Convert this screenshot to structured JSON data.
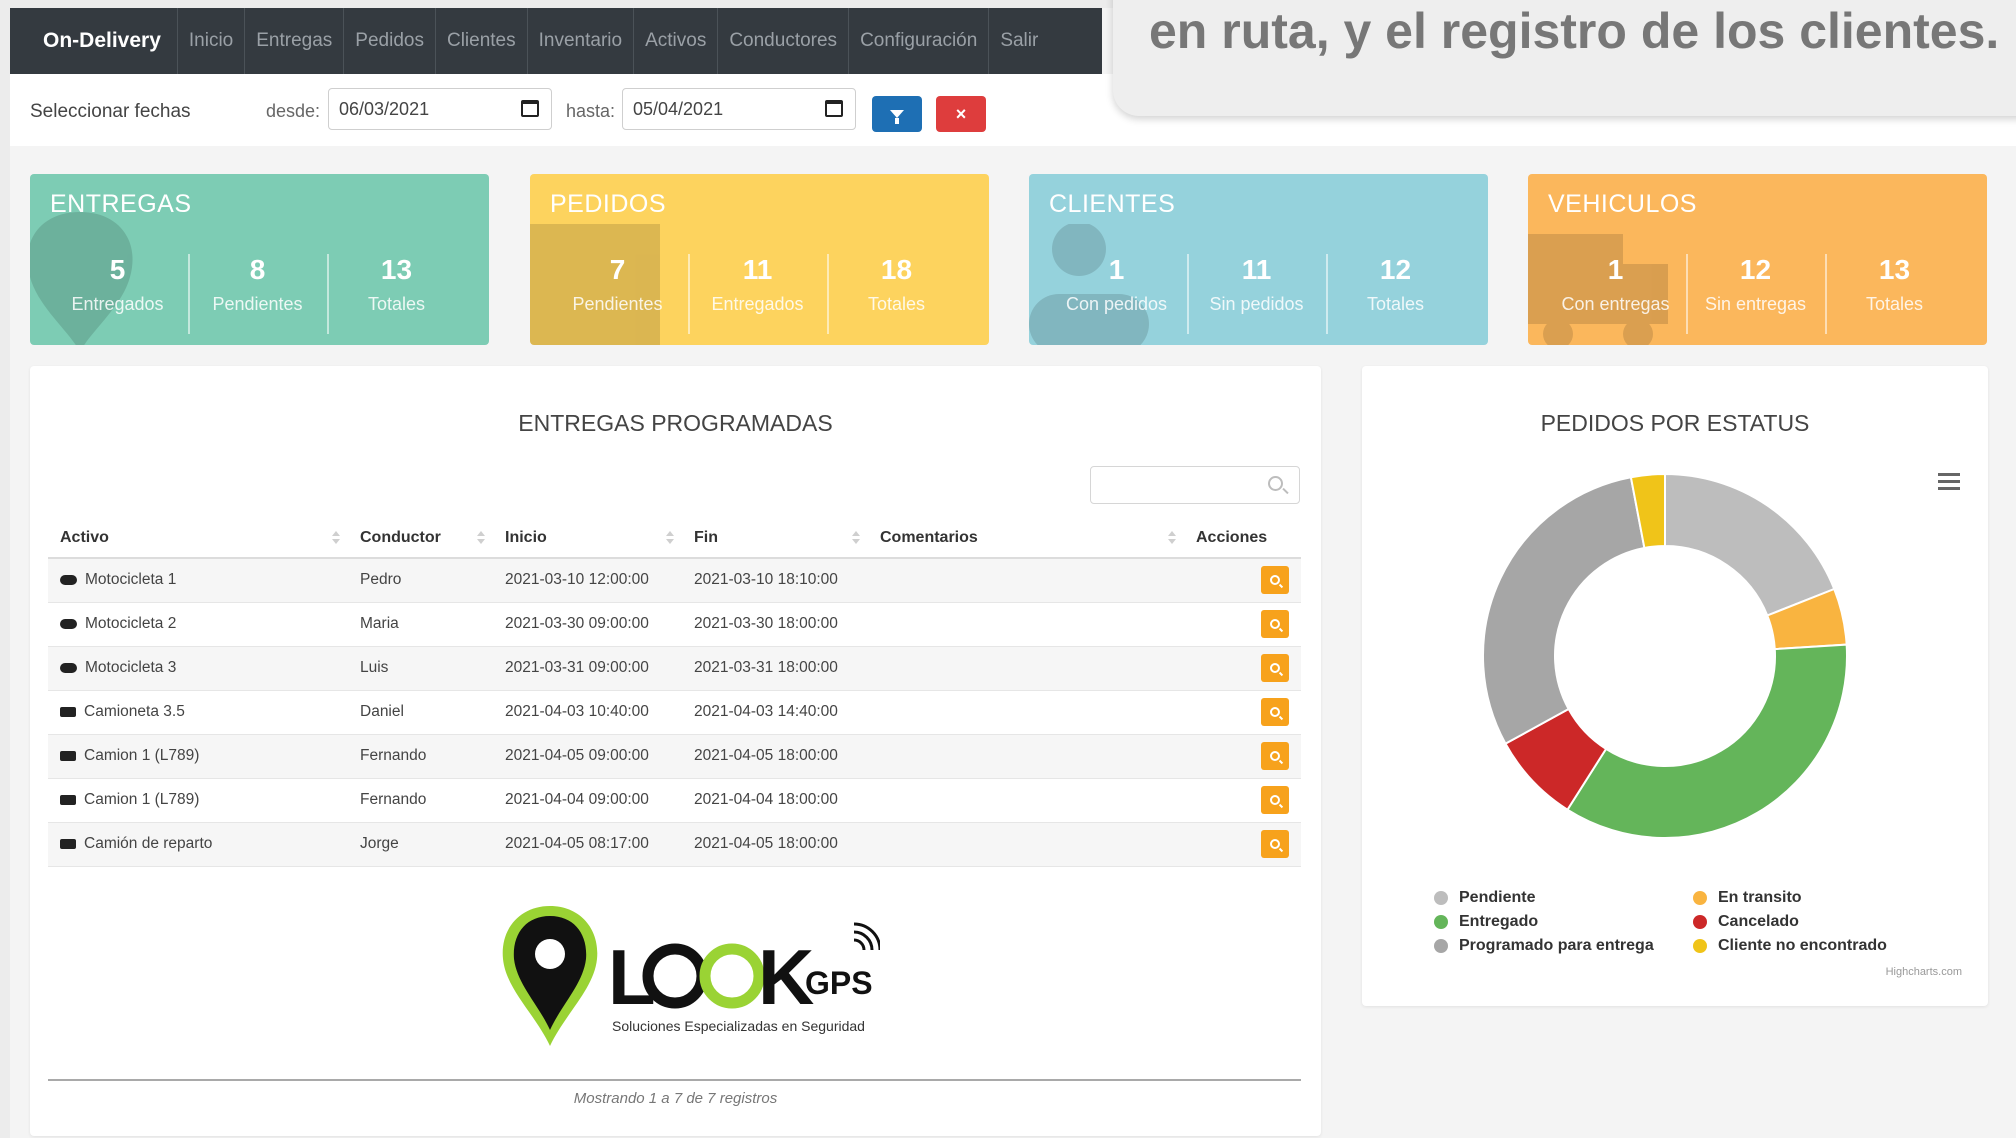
{
  "caption": "en ruta, y el registro de los clientes.",
  "navbar": {
    "brand": "On-Delivery",
    "items": [
      "Inicio",
      "Entregas",
      "Pedidos",
      "Clientes",
      "Inventario",
      "Activos",
      "Conductores",
      "Configuración",
      "Salir"
    ]
  },
  "filter": {
    "label": "Seleccionar fechas",
    "from_label": "desde:",
    "from_value": "06/03/2021",
    "to_label": "hasta:",
    "to_value": "05/04/2021",
    "filter_icon": "filter-icon",
    "clear_label": "×"
  },
  "cards": [
    {
      "title": "ENTREGAS",
      "color": "#7dccb4",
      "icon": "map-pin-icon",
      "stats": [
        {
          "value": "5",
          "label": "Entregados"
        },
        {
          "value": "8",
          "label": "Pendientes"
        },
        {
          "value": "13",
          "label": "Totales"
        }
      ]
    },
    {
      "title": "PEDIDOS",
      "color": "#fdd35e",
      "icon": "package-icon",
      "stats": [
        {
          "value": "7",
          "label": "Pendientes"
        },
        {
          "value": "11",
          "label": "Entregados"
        },
        {
          "value": "18",
          "label": "Totales"
        }
      ]
    },
    {
      "title": "CLIENTES",
      "color": "#95d2dc",
      "icon": "user-icon",
      "stats": [
        {
          "value": "1",
          "label": "Con pedidos"
        },
        {
          "value": "11",
          "label": "Sin pedidos"
        },
        {
          "value": "12",
          "label": "Totales"
        }
      ]
    },
    {
      "title": "VEHICULOS",
      "color": "#fbb75c",
      "icon": "truck-icon",
      "stats": [
        {
          "value": "1",
          "label": "Con entregas"
        },
        {
          "value": "12",
          "label": "Sin entregas"
        },
        {
          "value": "13",
          "label": "Totales"
        }
      ]
    }
  ],
  "deliveries": {
    "title": "ENTREGAS PROGRAMADAS",
    "columns": [
      "Activo",
      "Conductor",
      "Inicio",
      "Fin",
      "Comentarios",
      "Acciones"
    ],
    "rows": [
      {
        "icon": "motorcycle-icon",
        "activo": "Motocicleta 1",
        "conductor": "Pedro",
        "inicio": "2021-03-10 12:00:00",
        "fin": "2021-03-10 18:10:00",
        "comentarios": ""
      },
      {
        "icon": "motorcycle-icon",
        "activo": "Motocicleta 2",
        "conductor": "Maria",
        "inicio": "2021-03-30 09:00:00",
        "fin": "2021-03-30 18:00:00",
        "comentarios": ""
      },
      {
        "icon": "motorcycle-icon",
        "activo": "Motocicleta 3",
        "conductor": "Luis",
        "inicio": "2021-03-31 09:00:00",
        "fin": "2021-03-31 18:00:00",
        "comentarios": ""
      },
      {
        "icon": "truck-icon",
        "activo": "Camioneta 3.5",
        "conductor": "Daniel",
        "inicio": "2021-04-03 10:40:00",
        "fin": "2021-04-03 14:40:00",
        "comentarios": ""
      },
      {
        "icon": "truck-icon",
        "activo": "Camion 1 (L789)",
        "conductor": "Fernando",
        "inicio": "2021-04-05 09:00:00",
        "fin": "2021-04-05 18:00:00",
        "comentarios": ""
      },
      {
        "icon": "truck-icon",
        "activo": "Camion 1 (L789)",
        "conductor": "Fernando",
        "inicio": "2021-04-04 09:00:00",
        "fin": "2021-04-04 18:00:00",
        "comentarios": ""
      },
      {
        "icon": "truck-icon",
        "activo": "Camión de reparto",
        "conductor": "Jorge",
        "inicio": "2021-04-05 08:17:00",
        "fin": "2021-04-05 18:00:00",
        "comentarios": ""
      }
    ],
    "info": "Mostrando 1 a 7 de 7 registros"
  },
  "logo": {
    "text_main": "LOOK",
    "text_gps": "GPS",
    "tagline": "Soluciones Especializadas en Seguridad"
  },
  "chart_data": {
    "type": "pie",
    "title": "PEDIDOS POR ESTATUS",
    "donut": true,
    "labels": [
      "Pendiente",
      "En transito",
      "Entregado",
      "Cancelado",
      "Programado para entrega",
      "Cliente no encontrado"
    ],
    "values": [
      19,
      5,
      35,
      8,
      30,
      3
    ],
    "colors": [
      "#bdbdbd",
      "#f9b440",
      "#64b55a",
      "#cc2828",
      "#a6a6a6",
      "#f0c419"
    ],
    "legend": "bottom",
    "credit": "Highcharts.com"
  }
}
